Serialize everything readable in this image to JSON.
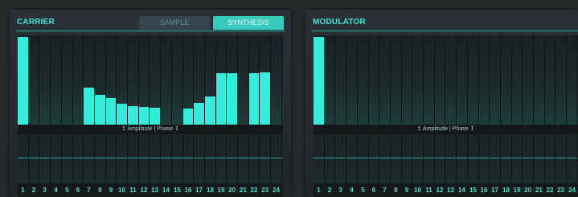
{
  "carrier": {
    "title": "CARRIER",
    "tabs": {
      "sample": "SAMPLE",
      "synthesis": "SYNTHESIS"
    },
    "separator_label": "↥ Amplitude | Phase ↧",
    "harmonic_count": 24,
    "amplitudes": [
      1.0,
      0,
      0,
      0,
      0,
      0,
      0.42,
      0.34,
      0.3,
      0.24,
      0.21,
      0.2,
      0.19,
      0,
      0,
      0.18,
      0.25,
      0.32,
      0.59,
      0.59,
      0,
      0.59,
      0.6,
      0
    ],
    "visible_columns": 24
  },
  "modulator": {
    "title": "MODULATOR",
    "separator_label": "↥ Amplitude | Phase ↧",
    "harmonic_count": 24,
    "amplitudes": [
      1.0,
      0,
      0,
      0,
      0,
      0,
      0,
      0,
      0,
      0,
      0,
      0,
      0,
      0,
      0,
      0,
      0,
      0,
      0,
      0,
      0,
      0,
      0,
      0
    ],
    "visible_columns": 24
  },
  "harmonic_numbers": [
    "1",
    "2",
    "3",
    "4",
    "5",
    "6",
    "7",
    "8",
    "9",
    "10",
    "11",
    "12",
    "13",
    "14",
    "15",
    "16",
    "17",
    "18",
    "19",
    "20",
    "21",
    "22",
    "23",
    "24"
  ],
  "colors": {
    "accent": "#35ebd9",
    "tab_active": "#37c9bc",
    "tab_inactive": "#36454e"
  }
}
